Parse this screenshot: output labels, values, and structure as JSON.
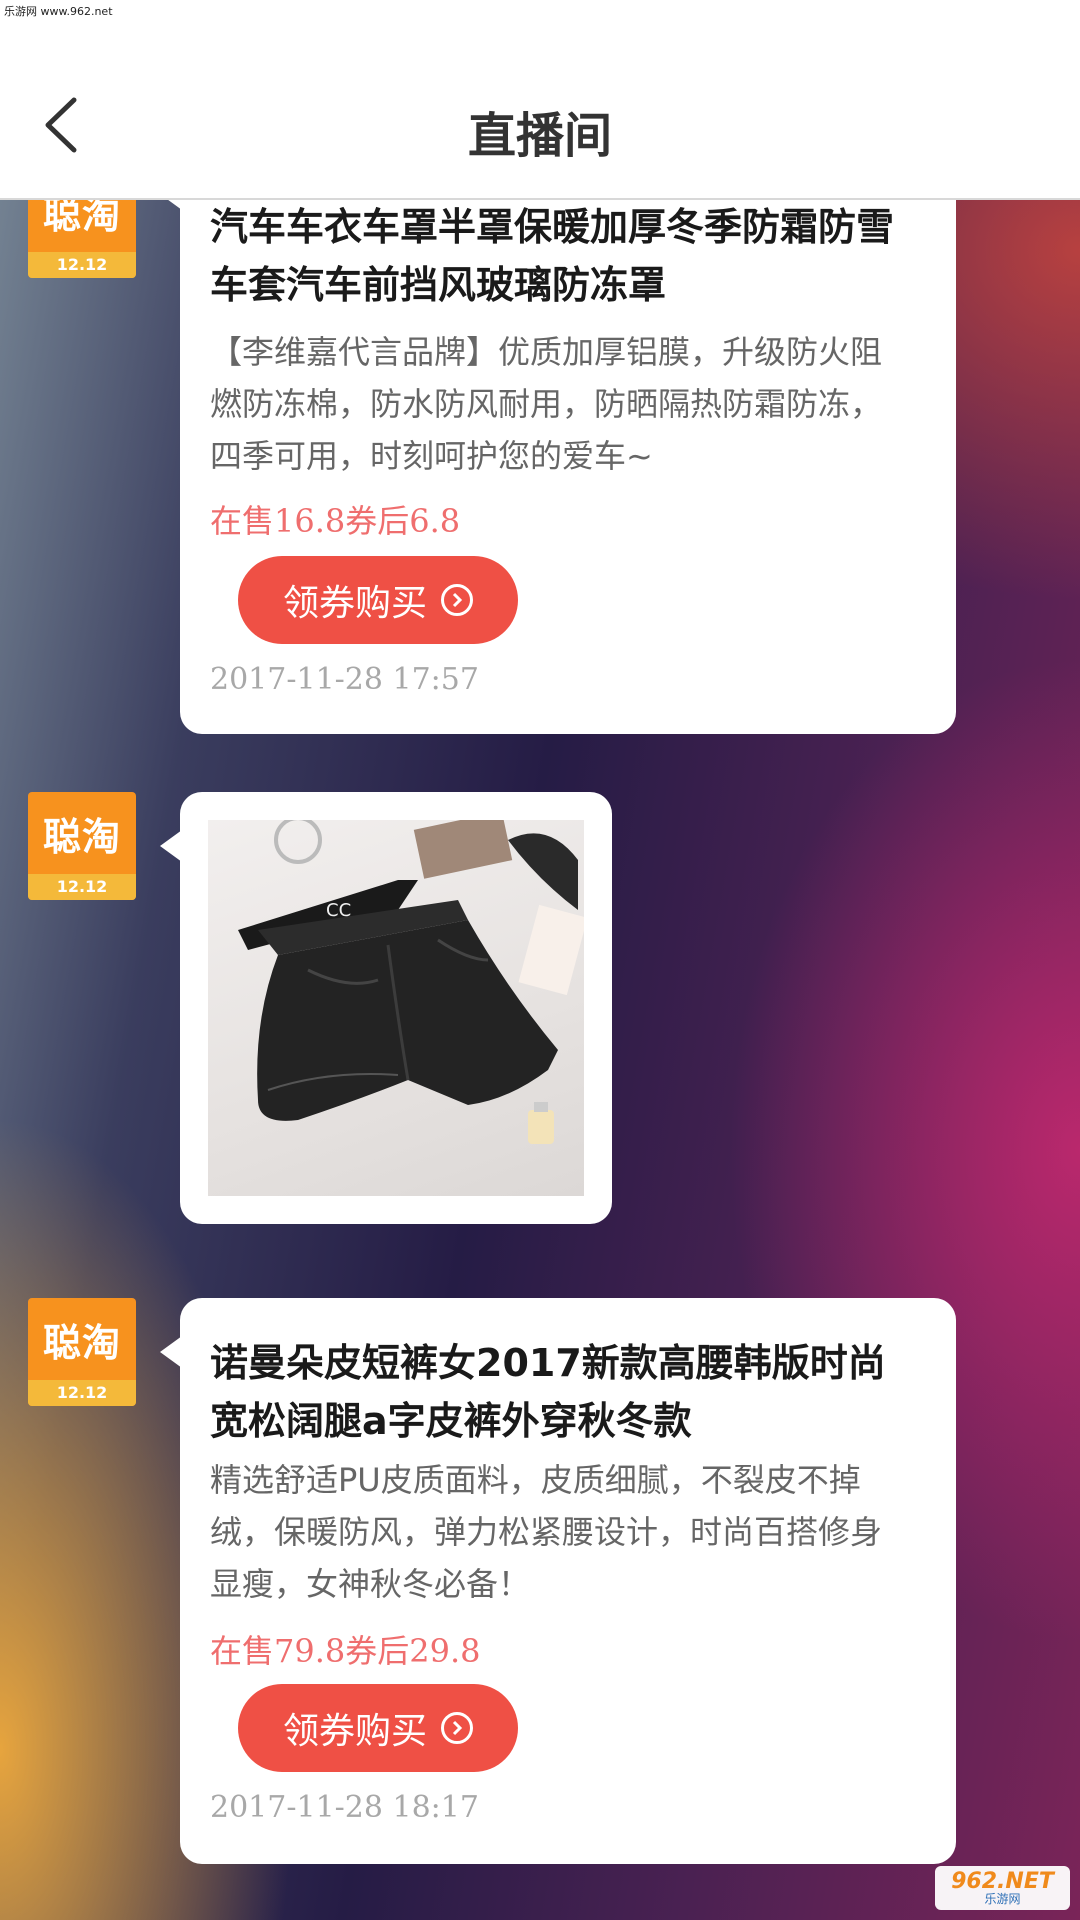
{
  "watermark_top": "乐游网 www.962.net",
  "header": {
    "title": "直播间",
    "back_icon": "chevron-left-icon"
  },
  "avatar": {
    "logo": "聪淘",
    "sub": "12.12"
  },
  "messages": [
    {
      "type": "product",
      "title": "汽车车衣车罩半罩保暖加厚冬季防霜防雪车套汽车前挡风玻璃防冻罩",
      "description": "【李维嘉代言品牌】优质加厚铝膜，升级防火阻燃防冻棉，防水防风耐用，防晒隔热防霜防冻，四季可用，时刻呵护您的爱车~",
      "price_text": "在售16.8券后6.8",
      "button_label": "领券购买",
      "timestamp": "2017-11-28 17:57"
    },
    {
      "type": "image",
      "image_desc": "black-leather-shorts-photo"
    },
    {
      "type": "product",
      "title": "诺曼朵皮短裤女2017新款高腰韩版时尚宽松阔腿a字皮裤外穿秋冬款",
      "description": "精选舒适PU皮质面料，皮质细腻，不裂皮不掉绒，保暖防风，弹力松紧腰设计，时尚百搭修身显瘦，女神秋冬必备！",
      "price_text": "在售79.8券后29.8",
      "button_label": "领券购买",
      "timestamp": "2017-11-28 18:17"
    }
  ],
  "watermark_bottom": {
    "big": "962.NET",
    "small": "乐游网"
  },
  "colors": {
    "accent": "#ef5045",
    "price": "#ef6e6e",
    "avatar_bg": "#f7921e"
  }
}
